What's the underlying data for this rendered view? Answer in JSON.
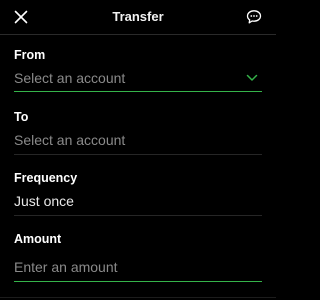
{
  "header": {
    "title": "Transfer",
    "close_icon": "close-icon",
    "chat_icon": "chat-bubble-icon"
  },
  "form": {
    "from": {
      "label": "From",
      "placeholder": "Select an account",
      "icon": "chevron-down-icon"
    },
    "to": {
      "label": "To",
      "placeholder": "Select an account"
    },
    "frequency": {
      "label": "Frequency",
      "value": "Just once"
    },
    "amount": {
      "label": "Amount",
      "placeholder": "Enter an amount"
    }
  },
  "colors": {
    "background": "#000000",
    "accent_green": "#35b34a",
    "placeholder_gray": "#8a8a8a",
    "text_white": "#ffffff"
  }
}
